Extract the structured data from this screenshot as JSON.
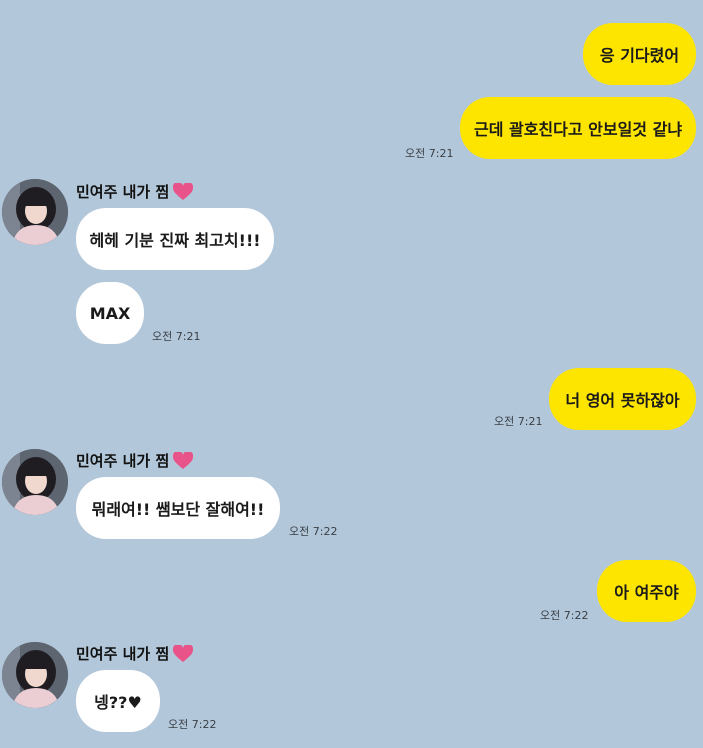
{
  "friend": {
    "name": "민여주 내가 찜"
  },
  "messages": [
    {
      "from": "me",
      "text": "응 기다렸어"
    },
    {
      "from": "me",
      "text": "근데 괄호친다고 안보일것 같냐",
      "time": "오전 7:21"
    },
    {
      "from": "friend",
      "text": "헤헤 기분 진짜 최고치!!!"
    },
    {
      "from": "friend",
      "text": "MAX",
      "time": "오전 7:21"
    },
    {
      "from": "me",
      "text": "너 영어 못하잖아",
      "time": "오전 7:21"
    },
    {
      "from": "friend",
      "text": "뭐래여!! 쌤보단 잘해여!!",
      "time": "오전 7:22"
    },
    {
      "from": "me",
      "text": "아 여주야",
      "time": "오전 7:22"
    },
    {
      "from": "friend",
      "text": "넹??♥",
      "time": "오전 7:22"
    }
  ],
  "colors": {
    "background": "#b2c7da",
    "my_bubble": "#fee500",
    "friend_bubble": "#ffffff",
    "heart": "#e8548a"
  }
}
